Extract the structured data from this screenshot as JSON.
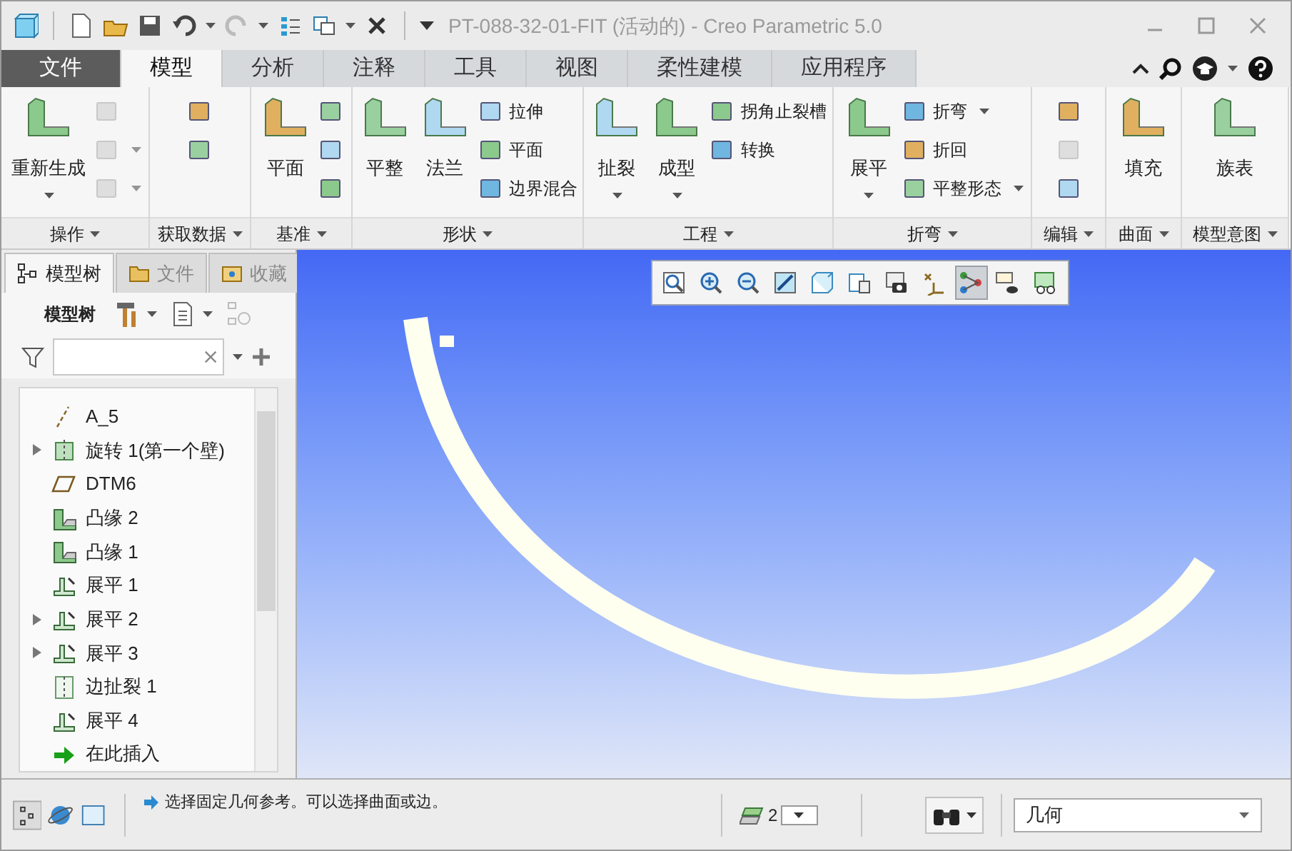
{
  "window": {
    "title": "PT-088-32-01-FIT (活动的) - Creo Parametric 5.0"
  },
  "tabs": [
    {
      "label": "文件",
      "kind": "file",
      "selected": false
    },
    {
      "label": "模型",
      "kind": "tab",
      "selected": true
    },
    {
      "label": "分析",
      "kind": "tab",
      "selected": false
    },
    {
      "label": "注释",
      "kind": "tab",
      "selected": false
    },
    {
      "label": "工具",
      "kind": "tab",
      "selected": false
    },
    {
      "label": "视图",
      "kind": "tab",
      "selected": false
    },
    {
      "label": "柔性建模",
      "kind": "tab",
      "selected": false
    },
    {
      "label": "应用程序",
      "kind": "tab",
      "selected": false
    }
  ],
  "ribbon_groups": [
    {
      "label": "操作",
      "columns": [
        {
          "kind": "large",
          "items": [
            {
              "label": "重新生成",
              "dropdown": true
            }
          ]
        },
        {
          "kind": "stack",
          "items": [
            {
              "dropdown": false,
              "disabled": true
            },
            {
              "dropdown": true,
              "disabled": true
            },
            {
              "dropdown": true,
              "disabled": true
            }
          ]
        }
      ]
    },
    {
      "label": "获取数据",
      "columns": [
        {
          "kind": "stack",
          "items": [
            {
              "dropdown": false,
              "disabled": false
            },
            {
              "dropdown": false,
              "disabled": false
            }
          ]
        }
      ]
    },
    {
      "label": "基准",
      "columns": [
        {
          "kind": "large",
          "items": [
            {
              "label": "平面",
              "dropdown": false
            }
          ]
        },
        {
          "kind": "stack",
          "items": [
            {
              "dropdown": false,
              "disabled": false
            },
            {
              "dropdown": false,
              "disabled": false
            },
            {
              "dropdown": false,
              "disabled": false
            }
          ]
        }
      ]
    },
    {
      "label": "形状",
      "columns": [
        {
          "kind": "large",
          "items": [
            {
              "label": "平整",
              "dropdown": false
            }
          ]
        },
        {
          "kind": "large",
          "items": [
            {
              "label": "法兰",
              "dropdown": false
            }
          ]
        },
        {
          "kind": "stack",
          "items": [
            {
              "label": "拉伸",
              "dropdown": false,
              "disabled": false
            },
            {
              "label": "平面",
              "dropdown": false,
              "disabled": false
            },
            {
              "label": "边界混合",
              "dropdown": false,
              "disabled": false
            }
          ]
        }
      ]
    },
    {
      "label": "工程",
      "columns": [
        {
          "kind": "large",
          "items": [
            {
              "label": "扯裂",
              "dropdown": true
            }
          ]
        },
        {
          "kind": "large",
          "items": [
            {
              "label": "成型",
              "dropdown": true
            }
          ]
        },
        {
          "kind": "stack",
          "items": [
            {
              "label": "拐角止裂槽",
              "dropdown": false,
              "disabled": false
            },
            {
              "label": "转换",
              "dropdown": false,
              "disabled": false
            }
          ]
        }
      ]
    },
    {
      "label": "折弯",
      "columns": [
        {
          "kind": "large",
          "items": [
            {
              "label": "展平",
              "dropdown": true
            }
          ]
        },
        {
          "kind": "stack",
          "items": [
            {
              "label": "折弯",
              "dropdown": true,
              "disabled": false
            },
            {
              "label": "折回",
              "dropdown": false,
              "disabled": false
            },
            {
              "label": "平整形态",
              "dropdown": true,
              "disabled": false
            }
          ]
        }
      ]
    },
    {
      "label": "编辑",
      "columns": [
        {
          "kind": "stack",
          "items": [
            {
              "dropdown": false,
              "disabled": false
            },
            {
              "dropdown": false,
              "disabled": true
            },
            {
              "dropdown": false,
              "disabled": false
            }
          ]
        }
      ]
    },
    {
      "label": "曲面",
      "columns": [
        {
          "kind": "large",
          "items": [
            {
              "label": "填充",
              "dropdown": false
            }
          ]
        }
      ]
    },
    {
      "label": "模型意图",
      "columns": [
        {
          "kind": "large",
          "items": [
            {
              "label": "族表",
              "dropdown": false
            }
          ]
        }
      ]
    }
  ],
  "left_tabs": [
    {
      "label": "模型树",
      "selected": true
    },
    {
      "label": "文件",
      "selected": false
    },
    {
      "label": "收藏",
      "selected": false
    }
  ],
  "tree_toolbar": {
    "label": "模型树"
  },
  "tree": [
    {
      "label": "A_5",
      "kind": "axis",
      "expandable": false
    },
    {
      "label": "旋转 1(第一个壁)",
      "kind": "revolve",
      "expandable": true
    },
    {
      "label": "DTM6",
      "kind": "plane",
      "expandable": false
    },
    {
      "label": "凸缘 2",
      "kind": "flange",
      "expandable": false
    },
    {
      "label": "凸缘 1",
      "kind": "flange",
      "expandable": false
    },
    {
      "label": "展平 1",
      "kind": "unbend",
      "expandable": false
    },
    {
      "label": "展平 2",
      "kind": "unbend",
      "expandable": true
    },
    {
      "label": "展平 3",
      "kind": "unbend",
      "expandable": true
    },
    {
      "label": "边扯裂 1",
      "kind": "rip",
      "expandable": false
    },
    {
      "label": "展平 4",
      "kind": "unbend",
      "expandable": false
    },
    {
      "label": "在此插入",
      "kind": "insert",
      "expandable": false
    }
  ],
  "view_toolbar": [
    {
      "selected": false
    },
    {
      "selected": false
    },
    {
      "selected": false
    },
    {
      "selected": false
    },
    {
      "selected": false
    },
    {
      "selected": false
    },
    {
      "selected": false
    },
    {
      "selected": false
    },
    {
      "selected": true
    },
    {
      "selected": false
    },
    {
      "selected": false
    }
  ],
  "status_bar": {
    "message": "选择固定几何参考。可以选择曲面或边。",
    "selected_count": "2",
    "filter": "几何"
  }
}
